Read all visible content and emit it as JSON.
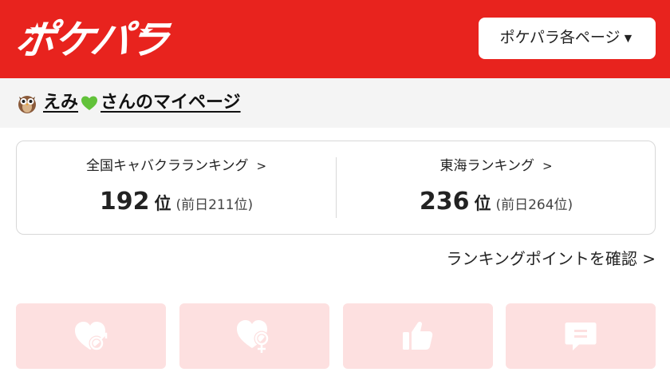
{
  "header": {
    "logo_text": "ポケパラ",
    "pages_button_label": "ポケパラ各ページ",
    "pages_button_arrow": "▼"
  },
  "mypage": {
    "name": "えみ",
    "suffix": "さんのマイページ"
  },
  "rankings": [
    {
      "title": "全国キャバクラランキング",
      "chevron": ">",
      "rank": "192",
      "unit": "位",
      "previous": "(前日211位)"
    },
    {
      "title": "東海ランキング",
      "chevron": ">",
      "rank": "236",
      "unit": "位",
      "previous": "(前日264位)"
    }
  ],
  "points_link": "ランキングポイントを確認 >",
  "actions": [
    {
      "icon": "heart-male-icon"
    },
    {
      "icon": "heart-female-icon"
    },
    {
      "icon": "thumbs-up-icon"
    },
    {
      "icon": "comment-icon"
    }
  ],
  "colors": {
    "brand_red": "#e8231e",
    "action_bg": "#fde0e0",
    "action_icon": "#ffffff"
  }
}
